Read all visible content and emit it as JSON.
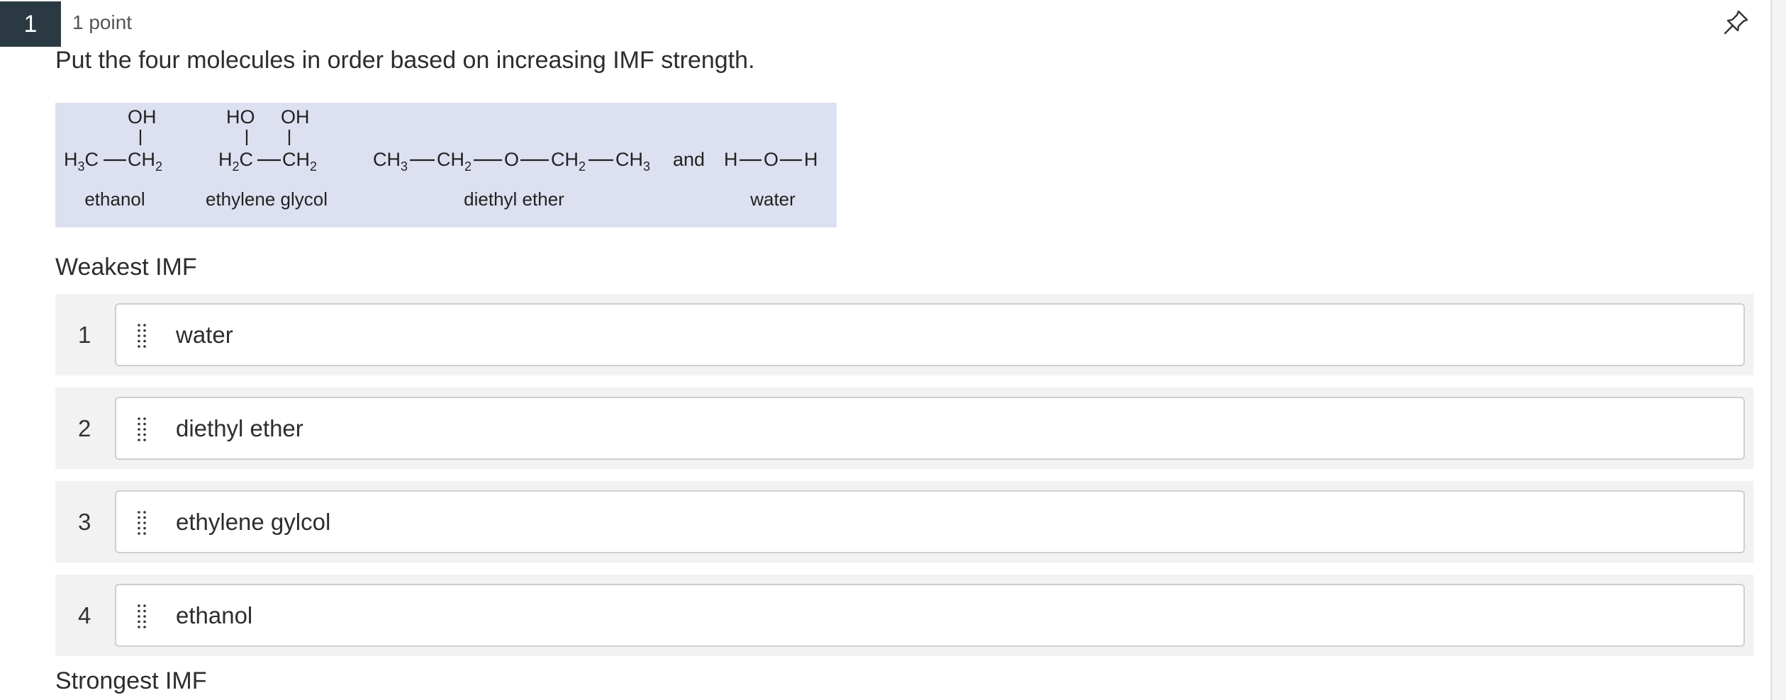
{
  "question": {
    "number": "1",
    "points": "1 point",
    "prompt": "Put the four molecules in order based on increasing IMF strength."
  },
  "icons": {
    "pin": "pin-icon",
    "drag_handle": "drag-handle-icon"
  },
  "figure": {
    "ethanol": {
      "top": "OH",
      "left_formula": "H3C",
      "right_formula": "CH2",
      "name": "ethanol"
    },
    "ethylene_glycol": {
      "top_left": "HO",
      "top_right": "OH",
      "left_formula": "H2C",
      "right_formula": "CH2",
      "name": "ethylene glycol"
    },
    "diethyl_ether": {
      "formula": "CH3—CH2—O—CH2—CH3",
      "name": "diethyl ether"
    },
    "conjunction": "and",
    "water": {
      "formula": "H—O—H",
      "name": "water"
    }
  },
  "labels": {
    "weakest": "Weakest IMF",
    "strongest": "Strongest IMF"
  },
  "ranking": [
    {
      "rank": "1",
      "label": "water"
    },
    {
      "rank": "2",
      "label": "diethyl ether"
    },
    {
      "rank": "3",
      "label": "ethylene gylcol"
    },
    {
      "rank": "4",
      "label": "ethanol"
    }
  ]
}
